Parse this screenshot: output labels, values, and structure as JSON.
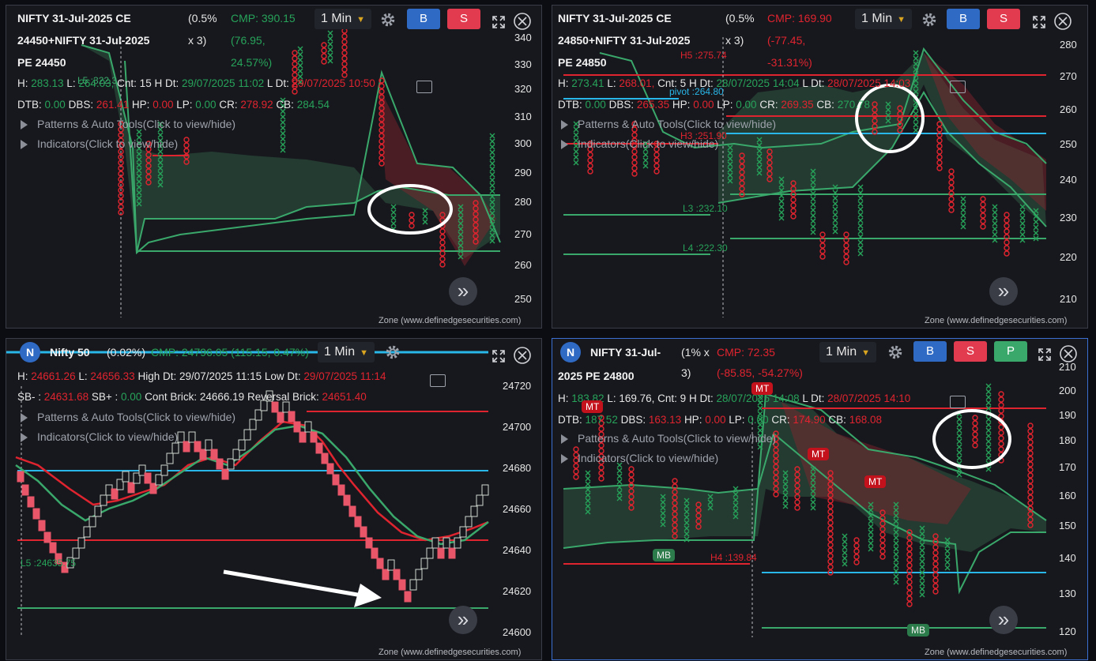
{
  "colors": {
    "bg": "#17181d",
    "green": "#27a35a",
    "red": "#e0242f",
    "cyan": "#29b6e8",
    "accent": "#2f6ac5"
  },
  "panels": [
    {
      "id": "tl",
      "title_line1": "NIFTY 31-Jul-2025 CE",
      "title_line2": "24450+NIFTY 31-Jul-2025",
      "title_line3": "PE 24450",
      "pct": "(0.5%",
      "mult": "x 3)",
      "cmp": "CMP: 390.15",
      "chg": "(76.95,",
      "chg_pct": "24.57%)",
      "timeframe": "1 Min",
      "buy": "B",
      "sell": "S",
      "row1": {
        "h_label": "H:",
        "h_val": "283.13",
        "l_label": "L:",
        "l_val": "264.03,",
        "cnt": "Cnt: 15",
        "hdt_label": "H Dt:",
        "hdt_val": "29/07/2025 11:02",
        "ldt_label": "L Dt:",
        "ldt_val": "29/07/2025 10:50"
      },
      "row2": {
        "dtb_label": "DTB:",
        "dtb_val": "0.00",
        "dbs_label": "DBS:",
        "dbs_val": "261.41",
        "hp_label": "HP:",
        "hp_val": "0.00",
        "lp_label": "LP:",
        "lp_val": "0.00",
        "cr_label": "CR:",
        "cr_val": "278.92",
        "cb_label": "CB:",
        "cb_val": "284.54"
      },
      "patterns": "Patterns & Auto Tools(Click to view/hide)",
      "indicators": "Indicators(Click to view/hide)",
      "yaxis": [
        "340",
        "330",
        "320",
        "310",
        "300",
        "290",
        "280",
        "270",
        "260",
        "250"
      ],
      "levels": [
        {
          "text": "L5 :322.3"
        }
      ],
      "zone": "Zone (www.definedgesecurities.com)",
      "ff": "»"
    },
    {
      "id": "tr",
      "title_line1": "NIFTY 31-Jul-2025 CE",
      "title_line2": "24850+NIFTY 31-Jul-2025",
      "title_line3": "PE 24850",
      "pct": "(0.5%",
      "mult": "x 3)",
      "cmp": "CMP: 169.90",
      "chg": "(-77.45,",
      "chg_pct": "-31.31%)",
      "timeframe": "1 Min",
      "buy": "B",
      "sell": "S",
      "row1": {
        "h_label": "H:",
        "h_val": "273.41",
        "l_label": "L:",
        "l_val": "268.01,",
        "cnt": "Cnt: 5",
        "hdt_label": "H Dt:",
        "hdt_val": "28/07/2025 14:04",
        "ldt_label": "L Dt:",
        "ldt_val": "28/07/2025 14:03"
      },
      "row2": {
        "dtb_label": "DTB:",
        "dtb_val": "0.00",
        "dbs_label": "DBS:",
        "dbs_val": "265.35",
        "hp_label": "HP:",
        "hp_val": "0.00",
        "lp_label": "LP:",
        "lp_val": "0.00",
        "cr_label": "CR:",
        "cr_val": "269.35",
        "cb_label": "CB:",
        "cb_val": "270.78"
      },
      "patterns": "Patterns & Auto Tools(Click to view/hide)",
      "indicators": "Indicators(Click to view/hide)",
      "yaxis": [
        "280",
        "270",
        "260",
        "250",
        "240",
        "230",
        "220",
        "210"
      ],
      "levels": [
        {
          "text": "H5 :275.74"
        },
        {
          "text": "pivot :264.80"
        },
        {
          "text": "H3 :251.90"
        },
        {
          "text": "L3 :232.10"
        },
        {
          "text": "L4 :222.30"
        }
      ],
      "zone": "Zone (www.definedgesecurities.com)",
      "ff": "»"
    },
    {
      "id": "bl",
      "badge": "N",
      "title_line1": "Nifty 50",
      "pct": "(0.02%)",
      "cmp": "CMP: 24796.05 (115.15, 0.47%)",
      "timeframe": "1 Min",
      "row1": {
        "h_label": "H:",
        "h_val": "24661.26",
        "l_label": "L:",
        "l_val": "24656.33",
        "hdt_label": "High Dt:",
        "hdt_val": "29/07/2025 11:15",
        "ldt_label": "Low Dt:",
        "ldt_val": "29/07/2025 11:14"
      },
      "row2": {
        "sbm_label": "SB- :",
        "sbm_val": "24631.68",
        "sbp_label": "SB+ :",
        "sbp_val": "0.00",
        "cont_label": "Cont Brick:",
        "cont_val": "24666.19",
        "rev_label": "Reversal Brick:",
        "rev_val": "24651.40"
      },
      "patterns": "Patterns & Auto Tools(Click to view/hide)",
      "indicators": "Indicators(Click to view/hide)",
      "yaxis": [
        "24720",
        "24700",
        "24680",
        "24660",
        "24640",
        "24620",
        "24600"
      ],
      "levels": [
        {
          "text": "L5 :24635.75"
        }
      ],
      "zone": "Zone (www.definedgesecurities.com)",
      "ff": "»"
    },
    {
      "id": "br",
      "badge": "N",
      "title_line1": "NIFTY 31-Jul-",
      "title_line2": "2025 PE 24800",
      "pct": "(1% x",
      "mult": "3)",
      "cmp": "CMP: 72.35",
      "chg": "(-85.85, -54.27%)",
      "timeframe": "1 Min",
      "buy": "B",
      "sell": "S",
      "pos": "P",
      "row1": {
        "h_label": "H:",
        "h_val": "183.82",
        "l_label": "L:",
        "l_val": "169.76,",
        "cnt": "Cnt: 9",
        "hdt_label": "H Dt:",
        "hdt_val": "28/07/2025 14:08",
        "ldt_label": "L Dt:",
        "ldt_val": "28/07/2025 14:10"
      },
      "row2": {
        "dtb_label": "DTB:",
        "dtb_val": "187.52",
        "dbs_label": "DBS:",
        "dbs_val": "163.13",
        "hp_label": "HP:",
        "hp_val": "0.00",
        "lp_label": "LP:",
        "lp_val": "0.00",
        "cr_label": "CR:",
        "cr_val": "174.90",
        "cb_label": "CB:",
        "cb_val": "168.08"
      },
      "patterns": "Patterns & Auto Tools(Click to view/hide)",
      "indicators": "Indicators(Click to view/hide)",
      "yaxis": [
        "210",
        "200",
        "190",
        "180",
        "170",
        "160",
        "150",
        "140",
        "130",
        "120"
      ],
      "levels": [
        {
          "text": "H4 :139.84"
        }
      ],
      "tags": [
        "MT",
        "MT",
        "MT",
        "MT",
        "MB",
        "MB"
      ],
      "zone": "Zone (www.definedgesecurities.com)",
      "ff": "»"
    }
  ]
}
